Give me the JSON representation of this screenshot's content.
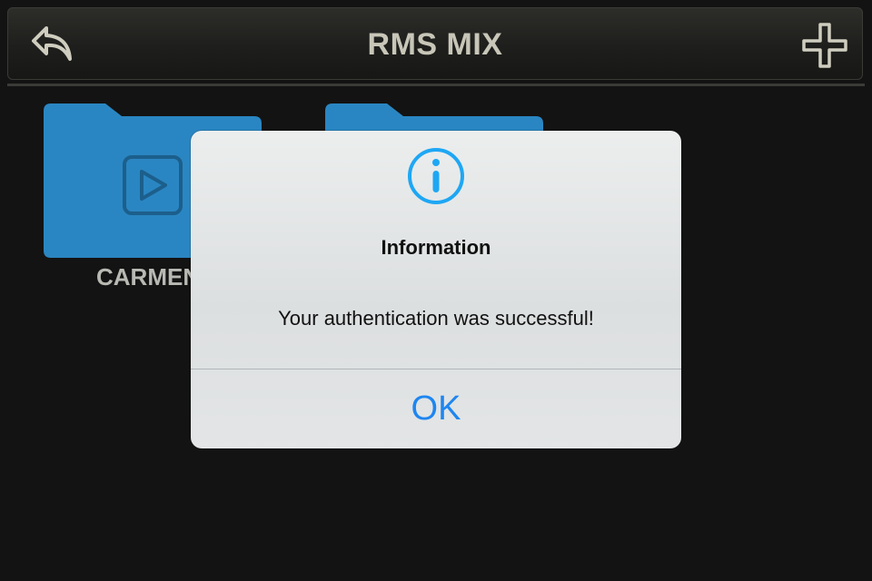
{
  "header": {
    "title": "RMS MIX",
    "back_icon": "reply-arrow-icon",
    "add_icon": "plus-icon"
  },
  "folders": [
    {
      "label": "CARMEN",
      "icon": "video-play-icon",
      "color": "#2a86c2"
    },
    {
      "label": "",
      "icon": "folder-icon",
      "color": "#2a86c2"
    }
  ],
  "alert": {
    "icon": "info-icon",
    "title": "Information",
    "message": "Your authentication was successful!",
    "ok_label": "OK",
    "accent_color": "#1e86f0"
  }
}
